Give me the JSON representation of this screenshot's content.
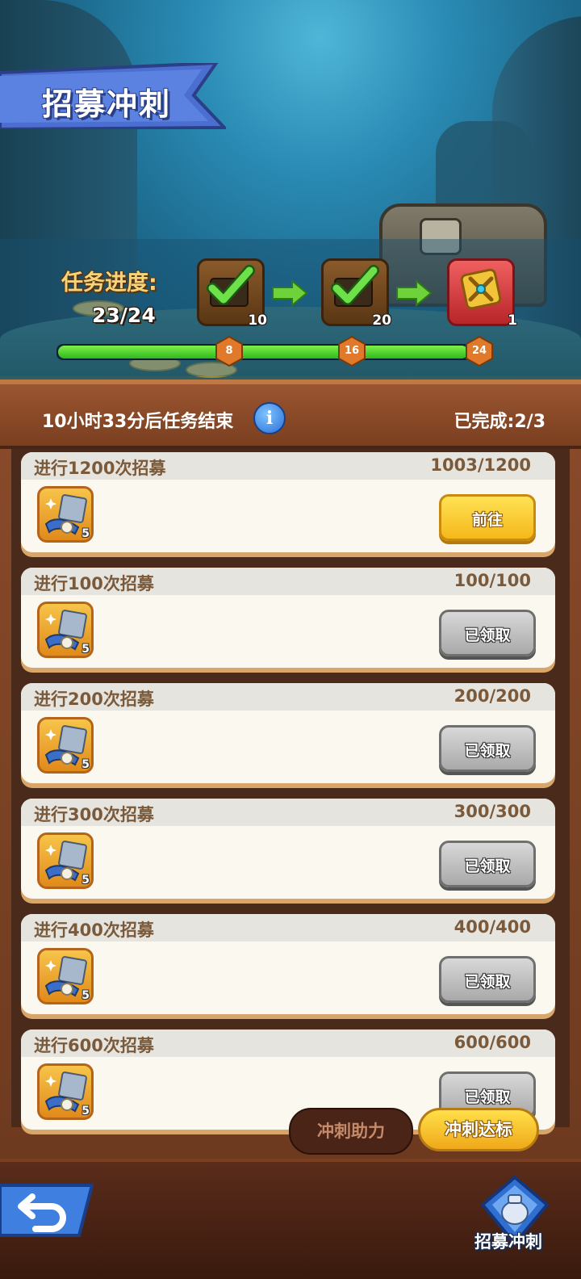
{
  "header": {
    "title": "招募冲刺"
  },
  "progress": {
    "label": "任务进度:",
    "count": "23/24",
    "current": 23,
    "max": 24,
    "milestones": [
      {
        "threshold": "8",
        "reward_count": "10",
        "claimed": true
      },
      {
        "threshold": "16",
        "reward_count": "20",
        "claimed": true
      },
      {
        "threshold": "24",
        "reward_count": "1",
        "claimed": false
      }
    ]
  },
  "info_bar": {
    "timer": "10小时33分后任务结束",
    "info_icon": "i",
    "completed": "已完成:2/3"
  },
  "tasks": [
    {
      "title": "进行1200次招募",
      "progress": "1003/1200",
      "reward_count": "5",
      "button": "前往",
      "state": "go"
    },
    {
      "title": "进行100次招募",
      "progress": "100/100",
      "reward_count": "5",
      "button": "已领取",
      "state": "claimed"
    },
    {
      "title": "进行200次招募",
      "progress": "200/200",
      "reward_count": "5",
      "button": "已领取",
      "state": "claimed"
    },
    {
      "title": "进行300次招募",
      "progress": "300/300",
      "reward_count": "5",
      "button": "已领取",
      "state": "claimed"
    },
    {
      "title": "进行400次招募",
      "progress": "400/400",
      "reward_count": "5",
      "button": "已领取",
      "state": "claimed"
    },
    {
      "title": "进行600次招募",
      "progress": "600/600",
      "reward_count": "5",
      "button": "已领取",
      "state": "claimed"
    }
  ],
  "tabs": {
    "assist": "冲刺助力",
    "active": "冲刺达标"
  },
  "footer": {
    "recruit_label": "招募冲刺"
  },
  "colors": {
    "go_button": "#f5b81a",
    "claimed_button": "#a9a9a9",
    "progress_fill": "#2fb81e"
  }
}
